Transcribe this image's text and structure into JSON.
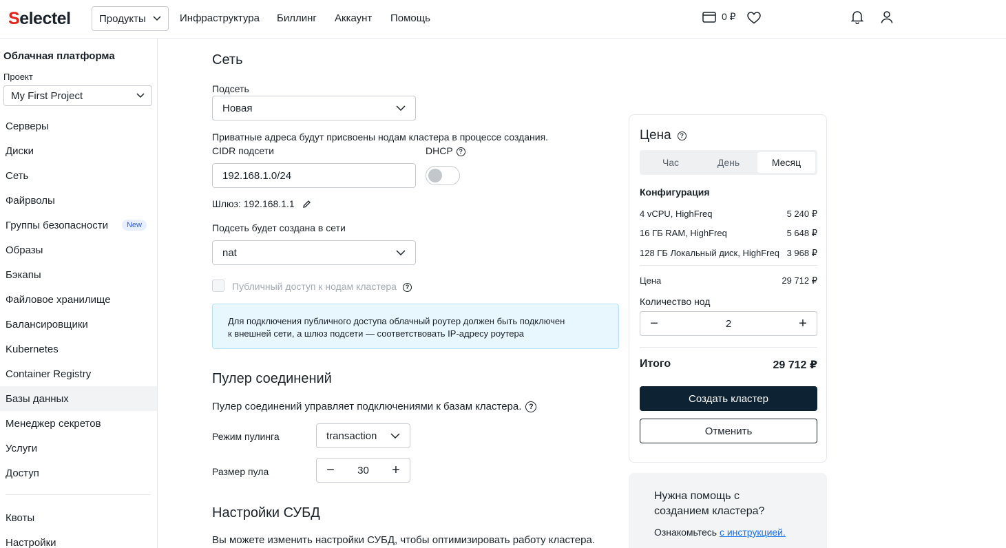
{
  "header": {
    "logo": "Selectel",
    "products_label": "Продукты",
    "nav": [
      "Инфраструктура",
      "Биллинг",
      "Аккаунт",
      "Помощь"
    ],
    "balance": "0 ₽"
  },
  "sidebar": {
    "title": "Облачная платформа",
    "project_label": "Проект",
    "project_value": "My First Project",
    "items": [
      {
        "label": "Серверы"
      },
      {
        "label": "Диски"
      },
      {
        "label": "Сеть"
      },
      {
        "label": "Файрволы"
      },
      {
        "label": "Группы безопасности",
        "badge": "New"
      },
      {
        "label": "Образы"
      },
      {
        "label": "Бэкапы"
      },
      {
        "label": "Файловое хранилище"
      },
      {
        "label": "Балансировщики"
      },
      {
        "label": "Kubernetes"
      },
      {
        "label": "Container Registry"
      },
      {
        "label": "Базы данных"
      },
      {
        "label": "Менеджер секретов"
      },
      {
        "label": "Услуги"
      },
      {
        "label": "Доступ"
      }
    ],
    "bottom_items": [
      {
        "label": "Квоты"
      },
      {
        "label": "Настройки"
      }
    ]
  },
  "network": {
    "title": "Сеть",
    "subnet_label": "Подсеть",
    "subnet_value": "Новая",
    "private_note": "Приватные адреса будут присвоены нодам кластера в процессе создания.",
    "cidr_label": "CIDR подсети",
    "cidr_value": "192.168.1.0/24",
    "dhcp_label": "DHCP",
    "gateway_label": "Шлюз: 192.168.1.1",
    "network_label": "Подсеть будет создана в сети",
    "network_value": "nat",
    "public_access_label": "Публичный доступ к нодам кластера",
    "info_line1": "Для подключения публичного доступа облачный роутер должен быть подключен",
    "info_line2": "к внешней сети, а шлюз подсети — соответствовать IP-адресу роутера"
  },
  "pooler": {
    "title": "Пулер соединений",
    "description": "Пулер соединений управляет подключениями к базам кластера.",
    "mode_label": "Режим пулинга",
    "mode_value": "transaction",
    "size_label": "Размер пула",
    "size_value": "30"
  },
  "dbms": {
    "title": "Настройки СУБД",
    "description": "Вы можете изменить настройки СУБД, чтобы оптимизировать работу кластера."
  },
  "price": {
    "title": "Цена",
    "periods": [
      "Час",
      "День",
      "Месяц"
    ],
    "selected_period": "Месяц",
    "config_title": "Конфигурация",
    "config": [
      {
        "name": "4 vCPU, HighFreq",
        "price": "5 240 ₽"
      },
      {
        "name": "16 ГБ RAM, HighFreq",
        "price": "5 648 ₽"
      },
      {
        "name": "128 ГБ Локальный диск, HighFreq",
        "price": "3 968 ₽"
      }
    ],
    "price_label": "Цена",
    "price_value": "29 712 ₽",
    "nodes_label": "Количество нод",
    "nodes_value": "2",
    "total_label": "Итого",
    "total_value": "29 712 ₽",
    "create_button": "Создать кластер",
    "cancel_button": "Отменить"
  },
  "help": {
    "title": "Нужна помощь с созданием кластера?",
    "text": "Ознакомьтесь ",
    "link": "с инструкцией."
  }
}
